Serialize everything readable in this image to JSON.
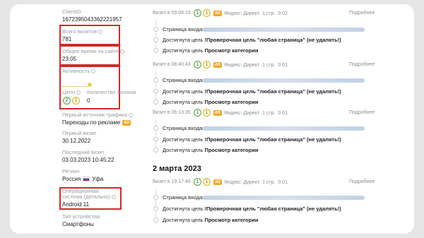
{
  "left": {
    "client_id_label": "ClientID",
    "client_id_value": "1672395043362221957",
    "total_visits_label": "Всего визитов",
    "total_visits_value": "781",
    "total_time_label": "Общее время на сайте",
    "total_time_value": "23:05",
    "activity_label": "Активность",
    "goals_label": "Цели",
    "goals_counts": [
      "2",
      "1"
    ],
    "count_label": "Количество звонков",
    "count_value": "0",
    "first_source_label": "Первый источник трафика",
    "first_source_value": "Переходы по рекламе",
    "ad_badge": "AD",
    "first_visit_label": "Первый визит",
    "first_visit_value": "30.12.2022",
    "last_visit_label": "Последний визит",
    "last_visit_value": "03.03.2023 10:45:22",
    "region_label": "Регион",
    "region_country": "Россия",
    "region_city": "Уфа",
    "os_label": "Операционная система (детально)",
    "os_value": "Android 11",
    "device_label": "Тип устройства",
    "device_value": "Смартфоны"
  },
  "visits": [
    {
      "time": "Визит в 09:08:15",
      "counts": [
        "1",
        "1"
      ],
      "ad": "AD",
      "source": "Яндекс: Директ",
      "pages": "1 стр.",
      "duration": "0:02",
      "more": "Подробнее",
      "events": [
        {
          "prefix": "Страница входа",
          "bold": "",
          "blur": true
        },
        {
          "prefix": "Достигнута цель ",
          "bold": "!Проверочная цель \"любая страница\" (не удалять!)",
          "blur": false
        },
        {
          "prefix": "Достигнута цель ",
          "bold": "Просмотр категории",
          "blur": false
        }
      ]
    },
    {
      "time": "Визит в 08:40:43",
      "counts": [
        "1",
        "1"
      ],
      "ad": "AD",
      "source": "Яндекс: Директ",
      "pages": "1 стр.",
      "duration": "0:01",
      "more": "Подробнее",
      "events": [
        {
          "prefix": "Страница входа",
          "bold": "",
          "blur": true
        },
        {
          "prefix": "Достигнута цель ",
          "bold": "!Проверочная цель \"любая страница\" (не удалять!)",
          "blur": false
        },
        {
          "prefix": "Достигнута цель ",
          "bold": "Просмотр категории",
          "blur": false
        }
      ]
    },
    {
      "time": "Визит в 06:13:35",
      "counts": [
        "1",
        "1"
      ],
      "ad": "AD",
      "source": "Яндекс: Директ",
      "pages": "1 стр.",
      "duration": "0:01",
      "more": "Подробнее",
      "events": [
        {
          "prefix": "Страница входа",
          "bold": "",
          "blur": true
        },
        {
          "prefix": "Достигнута цель ",
          "bold": "!Проверочная цель \"любая страница\" (не удалять!)",
          "blur": false
        },
        {
          "prefix": "Достигнута цель ",
          "bold": "Просмотр категории",
          "blur": false
        }
      ]
    },
    {
      "time": "Визит в 19:17:46",
      "counts": [
        "1",
        "1"
      ],
      "ad": "AD",
      "source": "Яндекс: Директ",
      "pages": "1 стр.",
      "duration": "0:01",
      "more": "Подробнее",
      "events": [
        {
          "prefix": "Страница входа",
          "bold": "",
          "blur": true
        },
        {
          "prefix": "Достигнута цель ",
          "bold": "!Проверочная цель \"любая страница\" (не удалять!)",
          "blur": false
        },
        {
          "prefix": "Достигнута цель ",
          "bold": "Просмотр категории",
          "blur": false
        }
      ]
    }
  ],
  "date_header": "2 марта 2023",
  "colors": {
    "highlight": "#d12a2a",
    "ad": "#f5a623",
    "goal_green": "#5aa34a",
    "goal_yellow": "#d7b81f"
  }
}
